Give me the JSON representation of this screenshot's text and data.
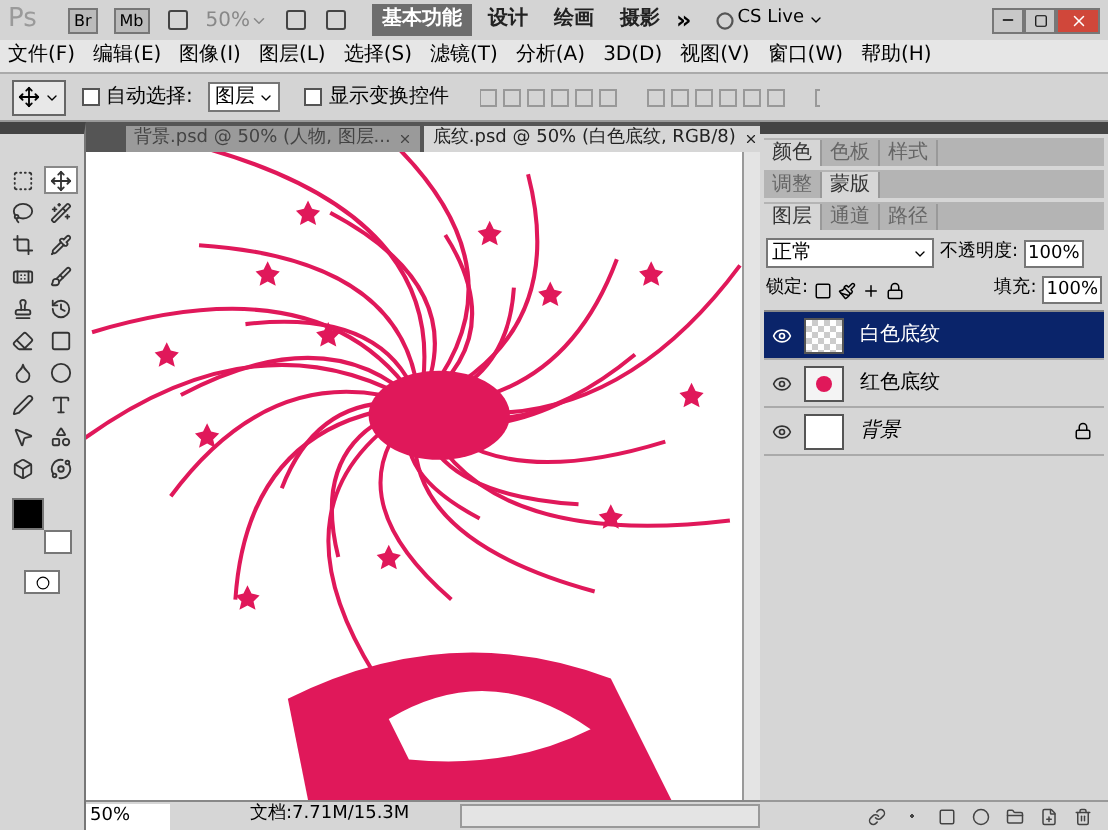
{
  "app_bar": {
    "logo": "Ps",
    "bridge": "Br",
    "mini_bridge": "Mb",
    "zoom": "50%",
    "workspaces": [
      {
        "label": "基本功能",
        "selected": true
      },
      {
        "label": "设计",
        "selected": false
      },
      {
        "label": "绘画",
        "selected": false
      },
      {
        "label": "摄影",
        "selected": false
      }
    ],
    "more": "»",
    "cs_live": "CS Live"
  },
  "menu": [
    "文件(F)",
    "编辑(E)",
    "图像(I)",
    "图层(L)",
    "选择(S)",
    "滤镜(T)",
    "分析(A)",
    "3D(D)",
    "视图(V)",
    "窗口(W)",
    "帮助(H)"
  ],
  "options_bar": {
    "auto_select": {
      "label": "自动选择:",
      "checked": false
    },
    "auto_select_target": "图层",
    "transform_controls": {
      "label": "显示变换控件",
      "checked": false
    }
  },
  "document_tabs": [
    {
      "label": "背景.psd @ 50% (人物, 图层...",
      "selected": false
    },
    {
      "label": "底纹.psd @ 50% (白色底纹, RGB/8)",
      "selected": true
    }
  ],
  "tools": [
    {
      "selected": false
    },
    {
      "selected": true
    },
    {
      "selected": false
    },
    {
      "selected": false
    },
    {
      "selected": false
    },
    {
      "selected": false
    },
    {
      "selected": false
    },
    {
      "selected": false
    },
    {
      "selected": false
    },
    {
      "selected": false
    },
    {
      "selected": false
    },
    {
      "selected": false
    },
    {
      "selected": false
    },
    {
      "selected": false
    },
    {
      "selected": false
    },
    {
      "selected": false
    },
    {
      "selected": false
    },
    {
      "selected": false
    },
    {
      "selected": false
    },
    {
      "selected": false
    }
  ],
  "status_bar": {
    "zoom": "50%",
    "doc_info": "文档:7.71M/15.3M"
  },
  "panel_groups": [
    {
      "tabs": [
        {
          "label": "颜色",
          "selected": true
        },
        {
          "label": "色板",
          "selected": false
        },
        {
          "label": "样式",
          "selected": false
        }
      ]
    },
    {
      "tabs": [
        {
          "label": "调整",
          "selected": false
        },
        {
          "label": "蒙版",
          "selected": true
        }
      ]
    },
    {
      "tabs": [
        {
          "label": "图层",
          "selected": true
        },
        {
          "label": "通道",
          "selected": false
        },
        {
          "label": "路径",
          "selected": false
        }
      ]
    }
  ],
  "layers_panel": {
    "blend_mode": "正常",
    "opacity_label": "不透明度:",
    "opacity": "100%",
    "lock_label": "锁定:",
    "fill_label": "填充:",
    "fill": "100%",
    "layers": [
      {
        "name": "白色底纹",
        "selected": true,
        "visible": true,
        "locked": false,
        "kind": "transparent"
      },
      {
        "name": "红色底纹",
        "selected": false,
        "visible": true,
        "locked": false,
        "kind": "pattern"
      },
      {
        "name": "背景",
        "selected": false,
        "visible": true,
        "locked": true,
        "kind": "solid"
      }
    ]
  }
}
